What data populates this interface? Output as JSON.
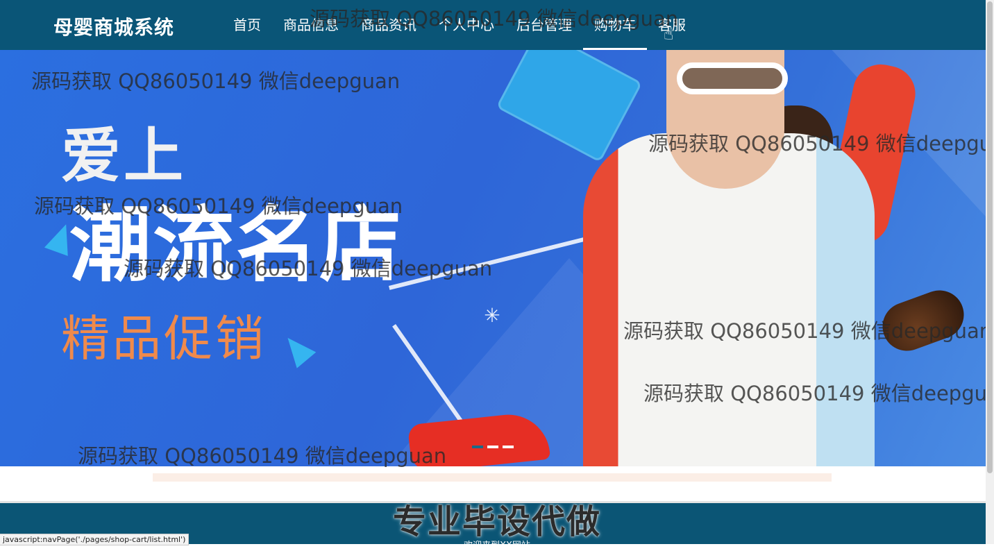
{
  "header": {
    "brand": "母婴商城系统",
    "nav": [
      {
        "label": "首页"
      },
      {
        "label": "商品信息"
      },
      {
        "label": "商品资讯"
      },
      {
        "label": "个人中心"
      },
      {
        "label": "后台管理"
      },
      {
        "label": "购物车",
        "active": true
      },
      {
        "label": "客服"
      }
    ]
  },
  "banner": {
    "line1": "爱上",
    "line2": "潮流名店",
    "line3": "精品促销",
    "slides": 3,
    "active_slide": 1
  },
  "watermark": "源码获取 QQ86050149 微信deepguan",
  "footer": {
    "title": "专业毕设代做",
    "welcome": "欢迎来到XX网站"
  },
  "status_bar": "javascript:navPage('./pages/shop-cart/list.html')",
  "colors": {
    "header_bg": "#0a5577",
    "banner_bg": "#2e66d8",
    "slogan_accent": "#f08a4b",
    "footer_bg": "#0b5575"
  }
}
